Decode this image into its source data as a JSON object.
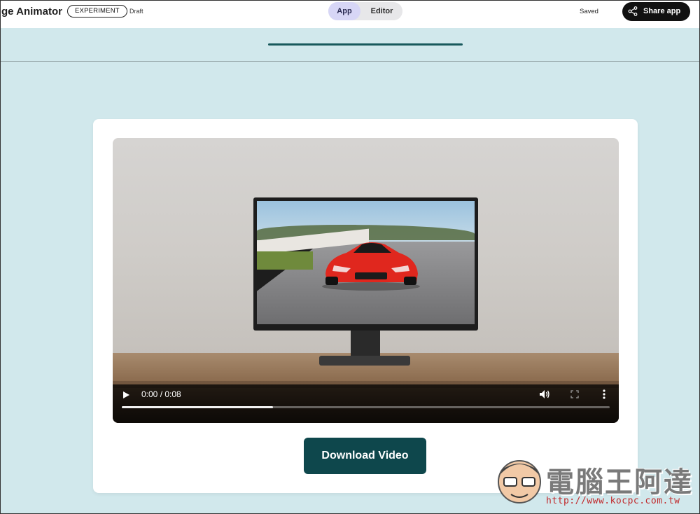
{
  "header": {
    "app_title": "ge Animator",
    "badge": "EXPERIMENT",
    "status": "Draft",
    "tabs": [
      {
        "label": "App",
        "active": true
      },
      {
        "label": "Editor",
        "active": false
      }
    ],
    "save_state": "Saved",
    "share_label": "Share app"
  },
  "video": {
    "time_display": "0:00 / 0:08",
    "played_fraction": 0.31,
    "icons": [
      "play-icon",
      "volume-icon",
      "fullscreen-icon",
      "more-options-icon"
    ]
  },
  "actions": {
    "download_label": "Download Video"
  },
  "watermark": {
    "text": "電腦王阿達",
    "url": "http://www.kocpc.com.tw"
  },
  "colors": {
    "accent": "#0e474c",
    "background": "#d1e8ec",
    "tab_active": "#d7d6f6"
  }
}
